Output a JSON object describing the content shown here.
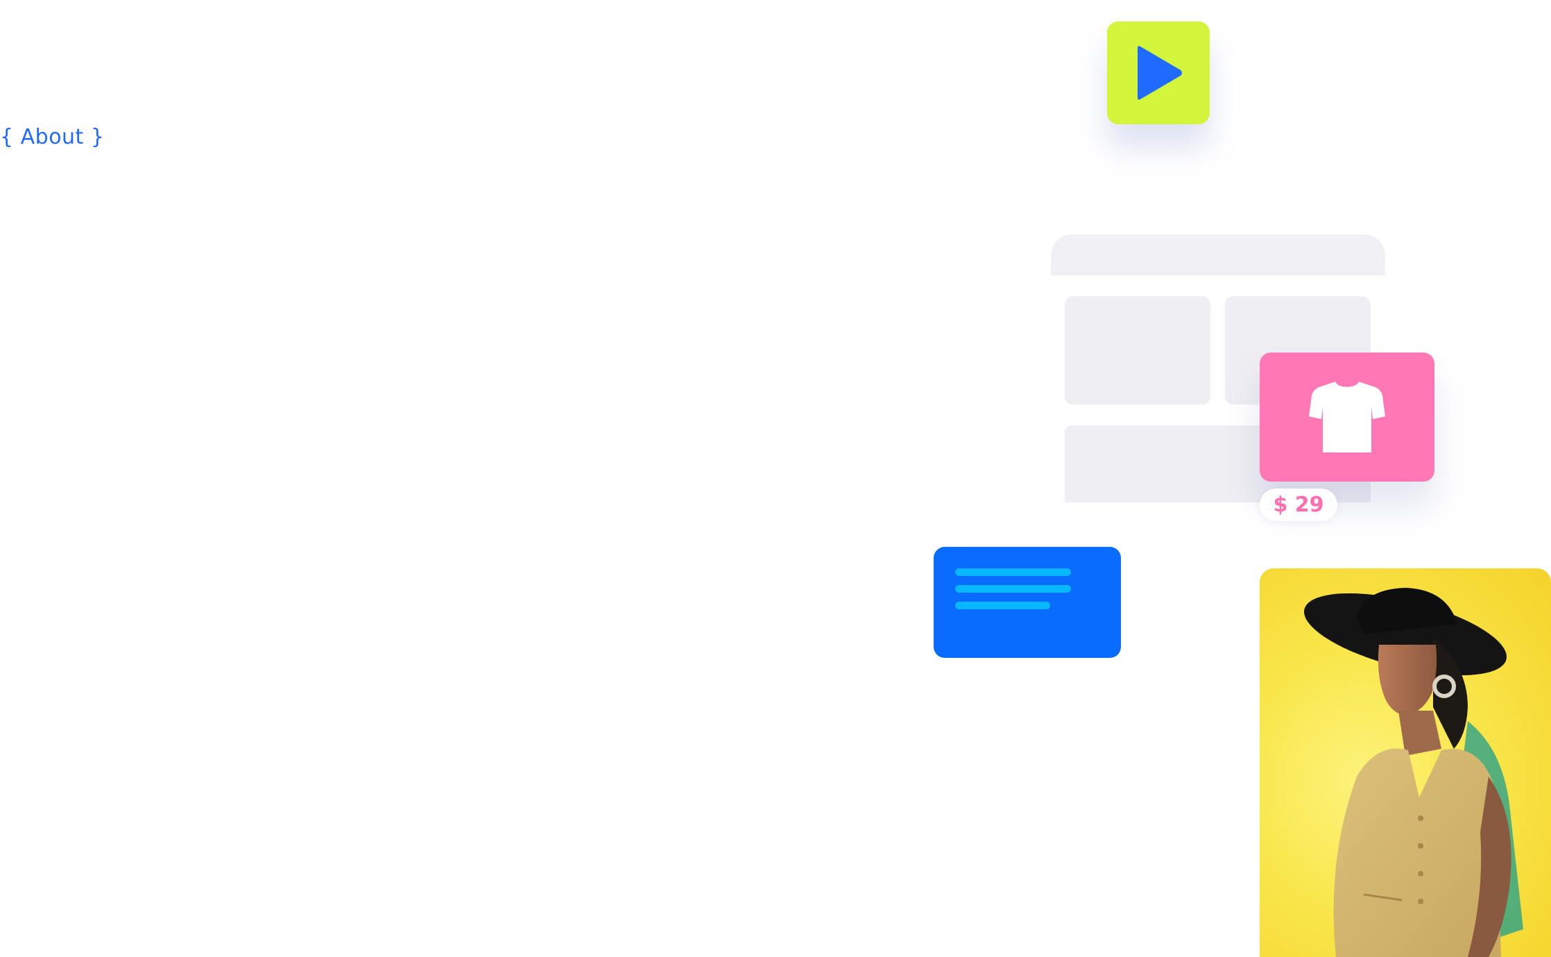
{
  "nav": {
    "about_label": "{ About }"
  },
  "play_tile": {
    "icon": "play-icon",
    "background": "#d2f53c",
    "icon_color": "#1f6bff"
  },
  "mockup": {
    "color": "#eeeef3"
  },
  "product": {
    "icon": "tshirt-icon",
    "background": "#ff78b5",
    "price": "$ 29"
  },
  "message_card": {
    "background": "#0a6bff",
    "line_color": "#07b7ff"
  },
  "photo": {
    "subject": "model-in-black-hat-and-beige-vest",
    "background": "#f9e64a"
  }
}
